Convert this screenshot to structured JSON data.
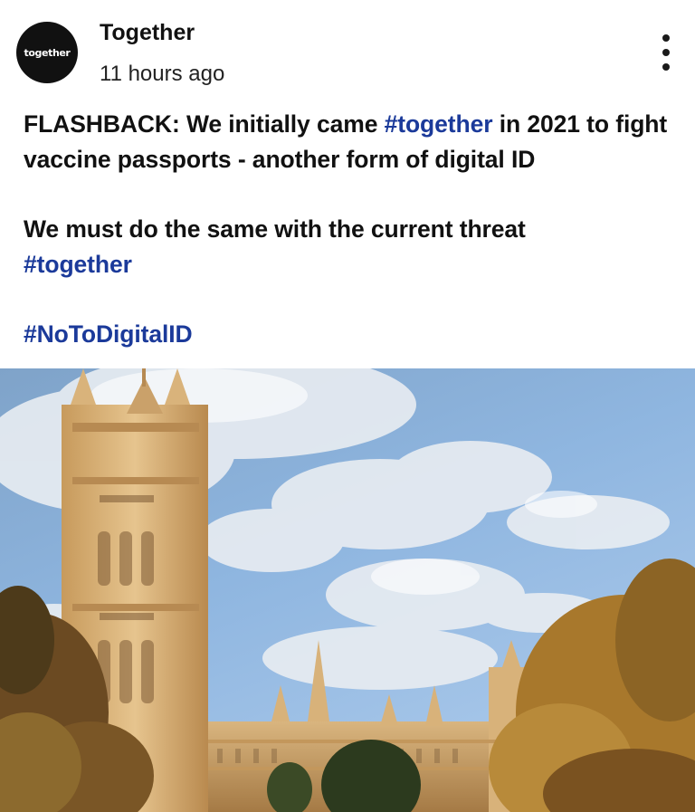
{
  "header": {
    "avatar_text": "together",
    "account_name": "Together",
    "timestamp": "11 hours ago",
    "more_icon": "more-vertical-icon"
  },
  "post": {
    "line1_prefix": "FLASHBACK: We initially came ",
    "line1_hashtag": "#together",
    "line1_suffix": " in 2021 to fight vaccine passports - another form of digital ID",
    "line2": "We must do the same with the current threat",
    "line2_hashtag": "#together",
    "line3_hashtag": "#NoToDigitalID"
  },
  "media": {
    "type": "photo",
    "subject": "Palace of Westminster, Victoria Tower"
  },
  "colors": {
    "hashtag": "#1b3a9a",
    "text": "#111111",
    "avatar_bg": "#111111"
  }
}
